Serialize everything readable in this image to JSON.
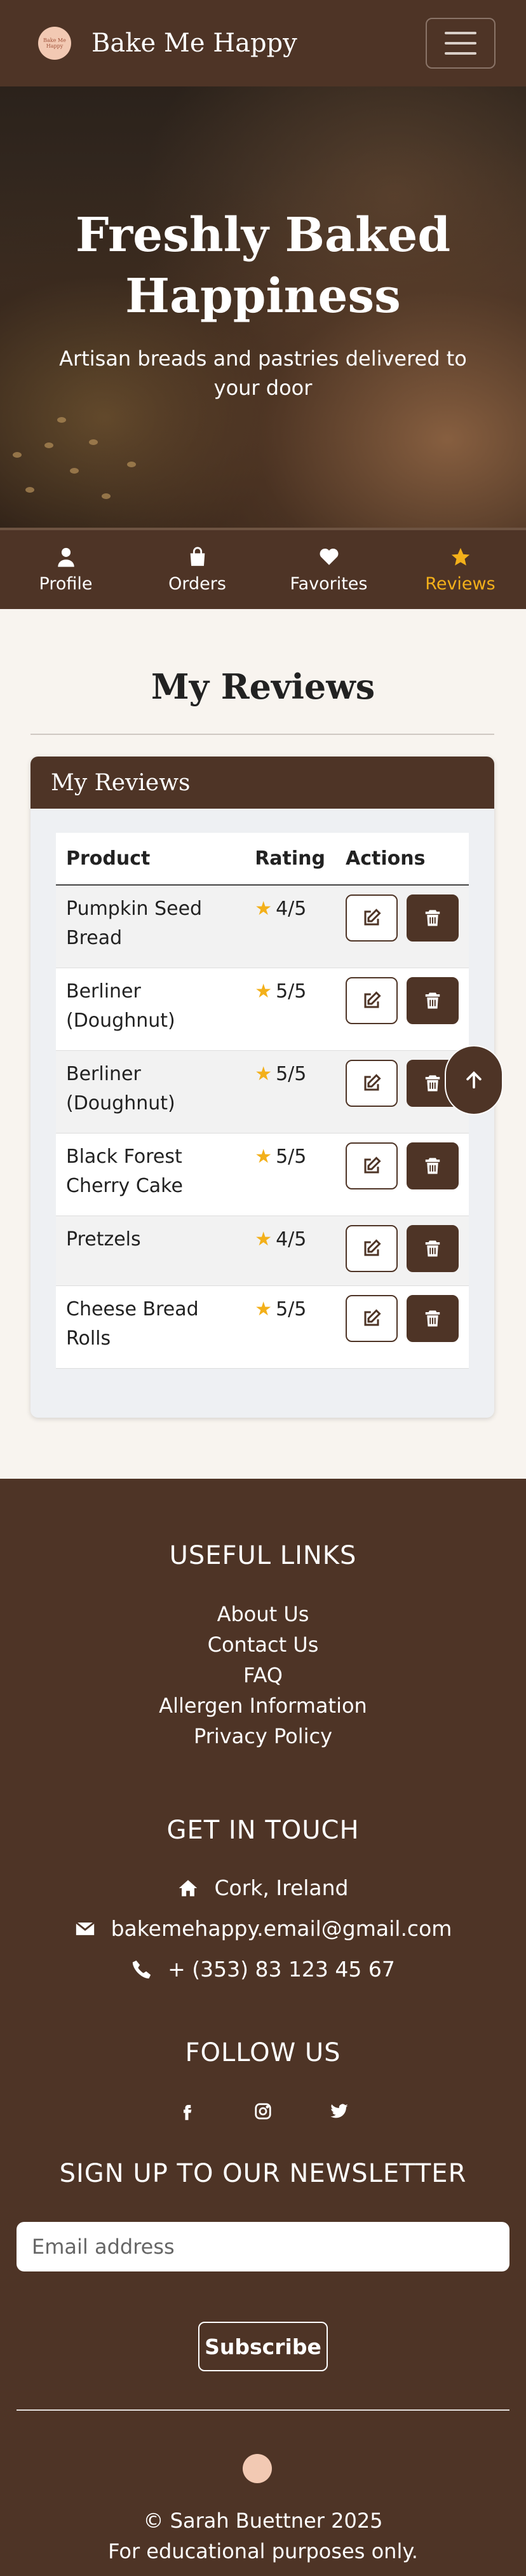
{
  "navbar": {
    "brand": "Bake Me Happy",
    "logo_text": "BAKE ME HAPPY",
    "menu_icon": "hamburger-icon"
  },
  "hero": {
    "title": "Freshly Baked Happiness",
    "subtitle": "Artisan breads and pastries delivered to your door"
  },
  "tabs": [
    {
      "label": "Profile",
      "icon": "user-icon",
      "active": false
    },
    {
      "label": "Orders",
      "icon": "shopping-bag-icon",
      "active": false
    },
    {
      "label": "Favorites",
      "icon": "heart-icon",
      "active": false
    },
    {
      "label": "Reviews",
      "icon": "star-icon",
      "active": true
    }
  ],
  "page": {
    "title": "My Reviews"
  },
  "reviews_card": {
    "header": "My Reviews",
    "columns": [
      "Product",
      "Rating",
      "Actions"
    ],
    "rows": [
      {
        "product": "Pumpkin Seed Bread",
        "rating": "4/5"
      },
      {
        "product": "Berliner (Doughnut)",
        "rating": "5/5"
      },
      {
        "product": "Berliner (Doughnut)",
        "rating": "5/5"
      },
      {
        "product": "Black Forest Cherry Cake",
        "rating": "5/5"
      },
      {
        "product": "Pretzels",
        "rating": "4/5"
      },
      {
        "product": "Cheese Bread Rolls",
        "rating": "5/5"
      }
    ]
  },
  "footer": {
    "useful_links_heading": "USEFUL LINKS",
    "links": [
      "About Us",
      "Contact Us",
      "FAQ",
      "Allergen Information",
      "Privacy Policy"
    ],
    "contact_heading": "GET IN TOUCH",
    "location": "Cork, Ireland",
    "email": "bakemehappy.email@gmail.com",
    "phone": "+ (353) 83 123 45 67",
    "follow_heading": "FOLLOW US",
    "social": [
      "facebook-icon",
      "instagram-icon",
      "twitter-icon"
    ],
    "newsletter_heading": "SIGN UP TO OUR NEWSLETTER",
    "email_placeholder": "Email address",
    "subscribe_label": "Subscribe",
    "copyright": "© Sarah Buettner 2025",
    "disclaimer": "For educational purposes only."
  },
  "colors": {
    "brand_brown": "#4e3426",
    "accent_gold": "#f3b01a",
    "page_bg": "#f8f4ef"
  }
}
